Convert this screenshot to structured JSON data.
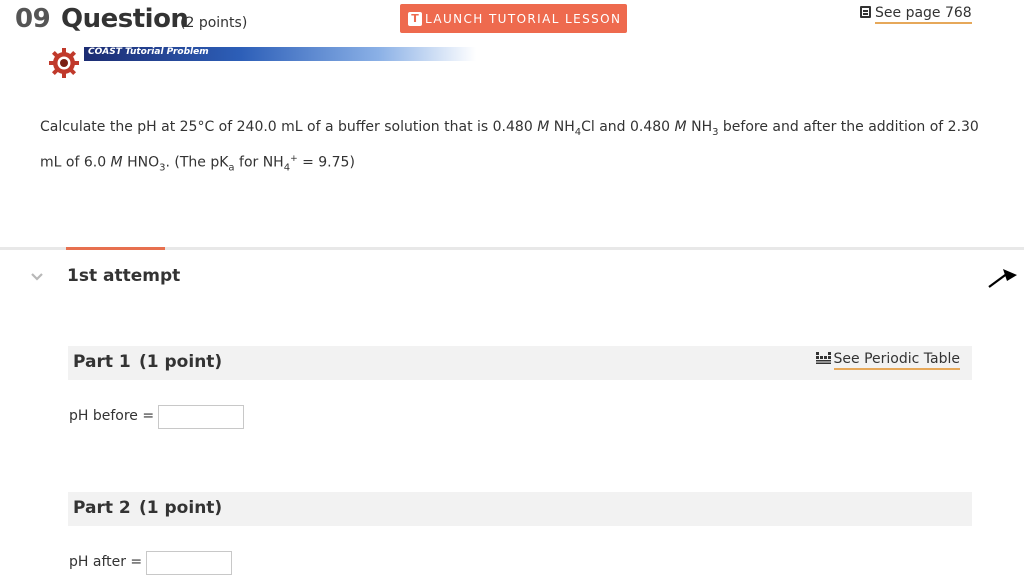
{
  "question": {
    "number": "09",
    "title": "Question",
    "points": "(2 points)"
  },
  "tutorial_button": {
    "icon_letter": "T",
    "label": "LAUNCH TUTORIAL LESSON"
  },
  "see_page": {
    "label": "See page 768"
  },
  "coast_banner": {
    "label": "COAST Tutorial Problem"
  },
  "problem": {
    "t1": "Calculate the pH at 25°C of 240.0 mL of a buffer solution that is 0.480 ",
    "m1": "M",
    "t2": " NH",
    "s1": "4",
    "t3": "Cl and 0.480 ",
    "m2": "M",
    "t4": " NH",
    "s2": "3",
    "t5": " before and after the addition of 2.30 mL of 6.0 ",
    "m3": "M",
    "t6": " HNO",
    "s3": "3",
    "t7": ". (The pK",
    "s4": "a",
    "t8": " for NH",
    "s5": "4",
    "sup1": "+",
    "t9": " = 9.75)"
  },
  "attempt": {
    "label": "1st attempt"
  },
  "parts": [
    {
      "label": "Part 1",
      "points": "(1 point)",
      "periodic_link": "See Periodic Table",
      "field_label": "pH before =",
      "value": ""
    },
    {
      "label": "Part 2",
      "points": "(1 point)",
      "field_label": "pH after =",
      "value": ""
    }
  ],
  "colors": {
    "accent": "#ee6a4e",
    "link_underline": "#e6a85a",
    "banner_dark": "#1c2c72"
  },
  "icons": [
    "book-icon",
    "gear-icon",
    "chevron-down-icon",
    "periodic-table-icon",
    "cursor-arrow-icon",
    "tutorial-t-icon"
  ]
}
